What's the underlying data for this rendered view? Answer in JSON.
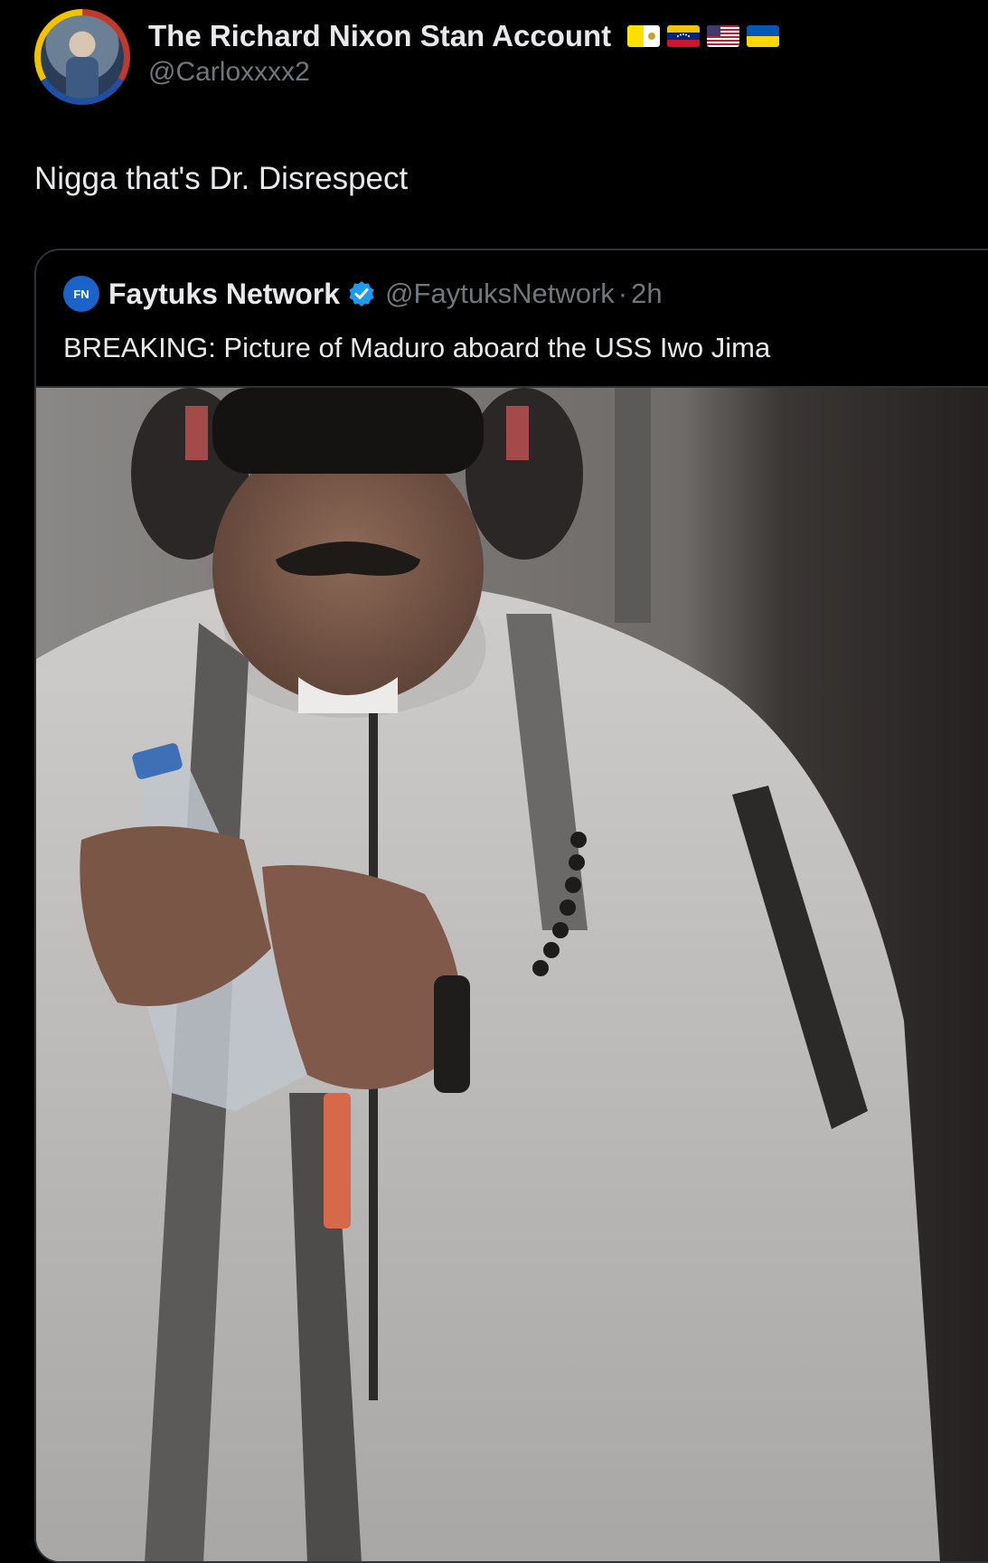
{
  "author": {
    "display_name": "The Richard Nixon Stan Account",
    "handle": "@Carloxxxx2",
    "avatar": "profile-photo",
    "flags": [
      "vatican-flag",
      "venezuela-flag",
      "usa-flag",
      "ukraine-flag"
    ]
  },
  "tweet": {
    "text": "Nigga that's Dr. Disrespect"
  },
  "quoted": {
    "logo_text": "FN",
    "display_name": "Faytuks Network",
    "verified": true,
    "handle": "@FaytuksNetwork",
    "separator": "·",
    "time": "2h",
    "text": "BREAKING: Picture of Maduro aboard the USS Iwo Jima",
    "media": "photo"
  },
  "colors": {
    "background": "#000000",
    "primary_text": "#e7e9ea",
    "secondary_text": "#71767b",
    "border": "#2f3336",
    "verified": "#1d9bf0"
  }
}
